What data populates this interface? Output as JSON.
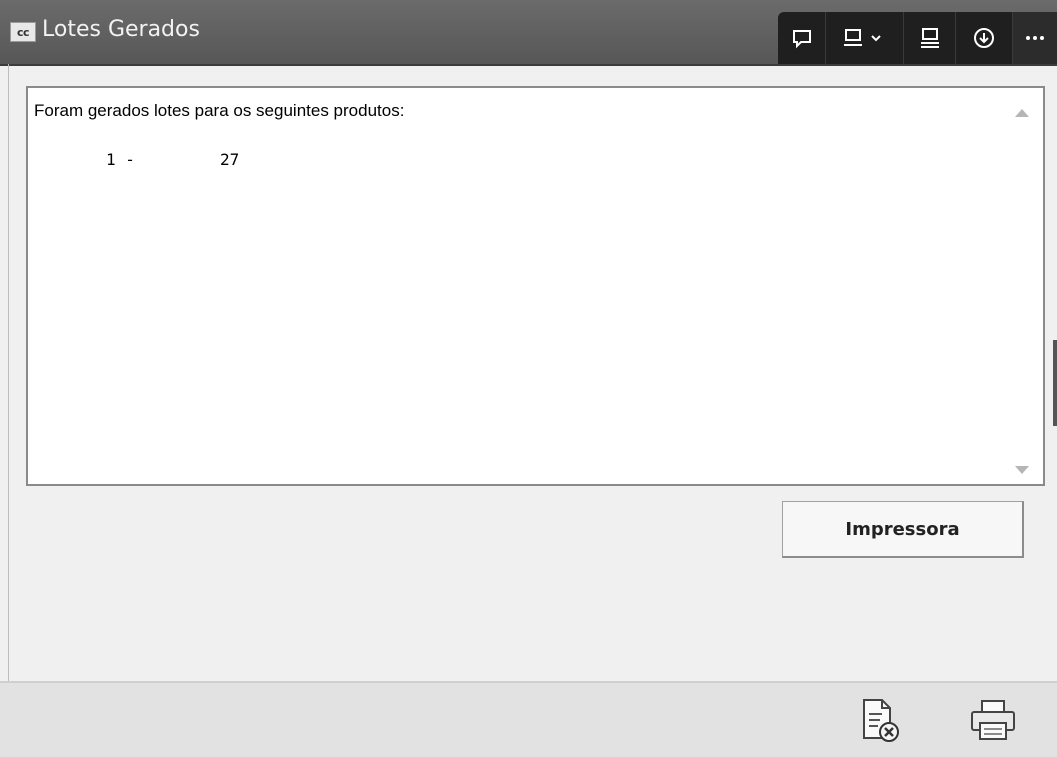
{
  "window": {
    "title": "Lotes Gerados",
    "app_icon_text": "cc"
  },
  "toolbar": {
    "icons": [
      "comment-icon",
      "panel-dropdown-icon",
      "layout-icon",
      "download-icon",
      "more-icon"
    ]
  },
  "content": {
    "message": "Foram gerados lotes para os seguintes produtos:",
    "lines": [
      {
        "number": "1 -",
        "value": "27"
      }
    ]
  },
  "buttons": {
    "impressora": "Impressora"
  },
  "footer": {
    "icons": [
      "cancel-document-icon",
      "printer-icon"
    ]
  },
  "colors": {
    "titlebar": "#5f5f5f",
    "toolbar": "#1f1f1f",
    "background": "#f0f0f0",
    "footer": "#e2e2e2"
  }
}
